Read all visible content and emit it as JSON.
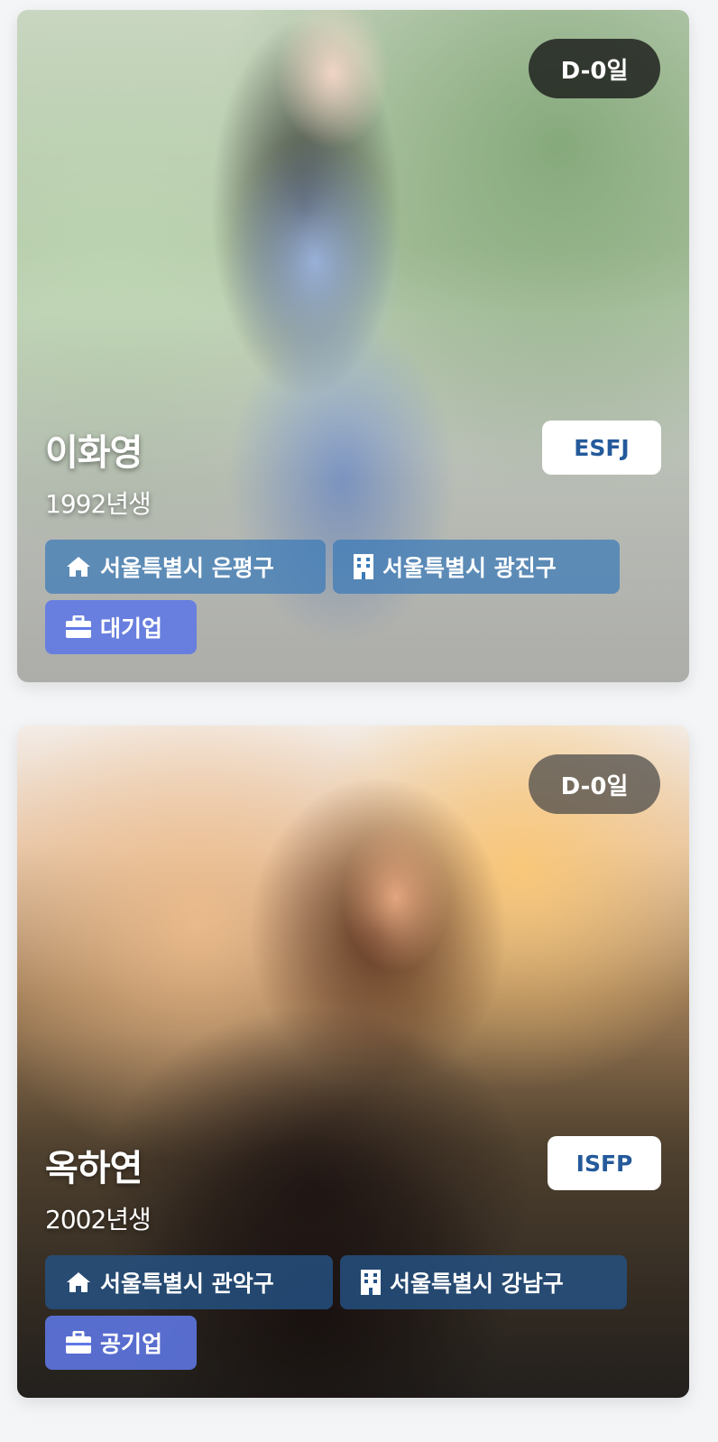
{
  "profiles": [
    {
      "d_day": "D-0일",
      "name": "이화영",
      "birth_year": "1992년생",
      "mbti": "ESFJ",
      "home": "서울특별시 은평구",
      "office": "서울특별시 광진구",
      "company_type": "대기업",
      "icons": [
        "home-icon",
        "building-icon",
        "briefcase-icon"
      ]
    },
    {
      "d_day": "D-0일",
      "name": "옥하연",
      "birth_year": "2002년생",
      "mbti": "ISFP",
      "home": "서울특별시 관악구",
      "office": "서울특별시 강남구",
      "company_type": "공기업",
      "icons": [
        "home-icon",
        "building-icon",
        "briefcase-icon"
      ]
    }
  ],
  "colors": {
    "mbti_text": "#255a9b",
    "location_chip": "#3a7ab8",
    "company_chip": "#5e78e6"
  }
}
